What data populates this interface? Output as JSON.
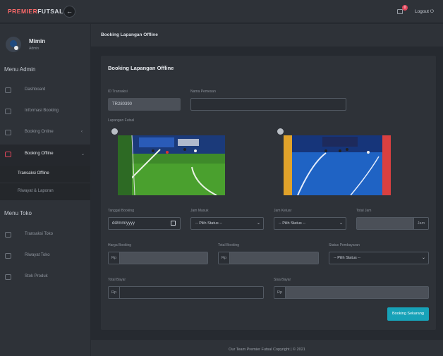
{
  "brand": {
    "part1": "PREMIER",
    "part2": "FUTSAL"
  },
  "topbar": {
    "cart_count": "0",
    "logout_label": "Logout"
  },
  "user": {
    "name": "Mimin",
    "role": "Admin"
  },
  "sidebar": {
    "section_admin": "Menu Admin",
    "admin_items": [
      {
        "label": "Dashboard",
        "icon": "dashboard-icon"
      },
      {
        "label": "Informasi Booking",
        "icon": "document-icon"
      },
      {
        "label": "Booking Online",
        "icon": "monitor-icon"
      },
      {
        "label": "Booking Offline",
        "icon": "calendar-icon"
      }
    ],
    "sub_items": [
      {
        "label": "Transaksi Offline"
      },
      {
        "label": "Riwayat & Laporan"
      }
    ],
    "section_toko": "Menu Toko",
    "toko_items": [
      {
        "label": "Transaksi Toko",
        "icon": "dashboard-icon"
      },
      {
        "label": "Riwayat Toko",
        "icon": "document-icon"
      },
      {
        "label": "Stok Produk",
        "icon": "sound-icon"
      }
    ]
  },
  "page": {
    "header": "Booking Lapangan Offline",
    "card_title": "Booking Lapangan Offline"
  },
  "form": {
    "id_label": "ID Transaksi",
    "id_value": "TR280390",
    "nama_label": "Nama Pemesan",
    "nama_value": "",
    "lapangan_label": "Lapangan Futsal",
    "tanggal_label": "Tanggal Booking",
    "tanggal_placeholder": "dd/mm/yyyy",
    "jam_masuk_label": "Jam Masuk",
    "jam_masuk_value": "-- Pilih Status --",
    "jam_keluar_label": "Jam Keluar",
    "jam_keluar_value": "-- Pilih Status --",
    "total_jam_label": "Total Jam",
    "total_jam_suffix": "Jam",
    "harga_label": "Harga Booking",
    "total_booking_label": "Total Booking",
    "status_label": "Status Pembayaran",
    "status_value": "-- Pilih Status --",
    "total_bayar_label": "Total Bayar",
    "sisa_bayar_label": "Sisa Bayar",
    "currency_prefix": "Rp",
    "submit_label": "Booking Sekarang"
  },
  "footer": {
    "text": "Our Team Premier Futsal Copyright | © 2021"
  },
  "colors": {
    "accent": "#17a2b8",
    "brand_red": "#ff6a6a",
    "badge": "#e0455a"
  }
}
